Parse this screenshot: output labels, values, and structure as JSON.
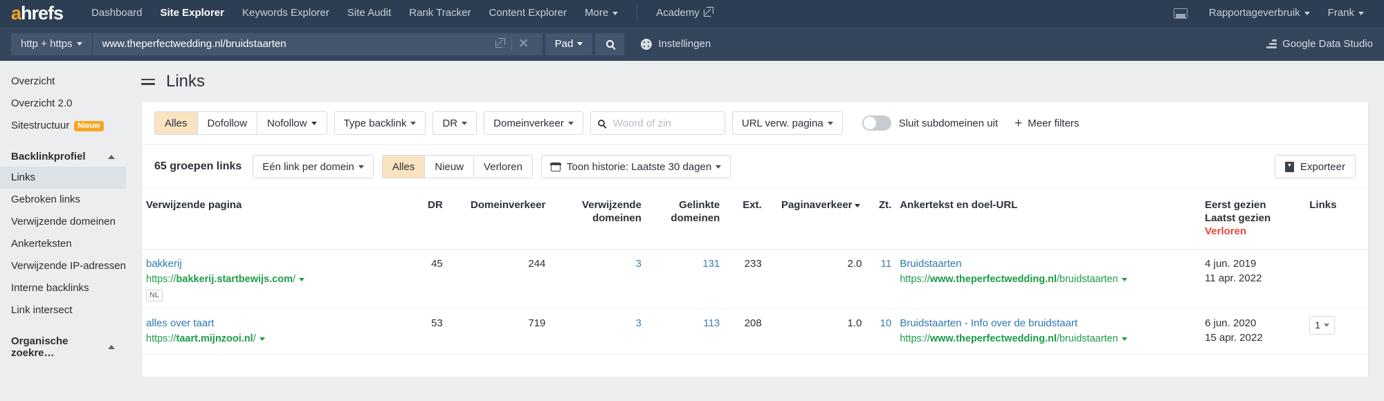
{
  "topnav": {
    "logo": "ahrefs",
    "logo_a": "a",
    "logo_rest": "hrefs",
    "items": [
      {
        "label": "Dashboard",
        "active": false,
        "caret": false
      },
      {
        "label": "Site Explorer",
        "active": true,
        "caret": false
      },
      {
        "label": "Keywords Explorer",
        "active": false,
        "caret": false
      },
      {
        "label": "Site Audit",
        "active": false,
        "caret": false
      },
      {
        "label": "Rank Tracker",
        "active": false,
        "caret": false
      },
      {
        "label": "Content Explorer",
        "active": false,
        "caret": false
      },
      {
        "label": "More",
        "active": false,
        "caret": true
      }
    ],
    "academy": "Academy",
    "report_usage": "Rapportageverbruik",
    "user": "Frank",
    "monitor_icon": "monitor-icon"
  },
  "searchbar": {
    "protocol": "http + https",
    "url_value": "www.theperfectwedding.nl/bruidstaarten",
    "open_external_icon": "external-link-icon",
    "clear_icon": "close-icon",
    "mode": "Pad",
    "search_icon": "search-icon",
    "settings": "Instellingen",
    "gear_icon": "gear-icon",
    "google_data_studio": "Google Data Studio",
    "gds_icon": "google-data-studio-icon"
  },
  "sidebar": {
    "top_items": [
      {
        "label": "Overzicht",
        "active": false
      },
      {
        "label": "Overzicht 2.0",
        "active": false
      },
      {
        "label": "Sitestructuur",
        "active": false,
        "badge": "Nieuw"
      }
    ],
    "section_title": "Backlinkprofiel",
    "items": [
      {
        "label": "Links",
        "active": true
      },
      {
        "label": "Gebroken links",
        "active": false
      },
      {
        "label": "Verwijzende domeinen",
        "active": false
      },
      {
        "label": "Ankerteksten",
        "active": false
      },
      {
        "label": "Verwijzende IP-adressen",
        "active": false
      },
      {
        "label": "Interne backlinks",
        "active": false
      },
      {
        "label": "Link intersect",
        "active": false
      }
    ],
    "section_title_2": "Organische zoekre…"
  },
  "page": {
    "title": "Links",
    "menu_icon": "hamburger-icon"
  },
  "filters": {
    "follow_segments": [
      {
        "label": "Alles",
        "on": true,
        "caret": false
      },
      {
        "label": "Dofollow",
        "on": false,
        "caret": false
      },
      {
        "label": "Nofollow",
        "on": false,
        "caret": true
      }
    ],
    "type_backlink": "Type backlink",
    "dr": "DR",
    "domeinverkeer": "Domeinverkeer",
    "search_placeholder": "Woord of zin",
    "search_value": "",
    "url_verw_pagina": "URL verw. pagina",
    "exclude_subdomains": "Sluit subdomeinen uit",
    "exclude_subdomains_on": false,
    "more_filters": "Meer filters"
  },
  "toolbar": {
    "groups_count": "65 groepen links",
    "per_domain": "Eén link per domein",
    "state_segments": [
      {
        "label": "Alles",
        "on": true
      },
      {
        "label": "Nieuw",
        "on": false
      },
      {
        "label": "Verloren",
        "on": false
      }
    ],
    "history": "Toon historie: Laatste 30 dagen",
    "calendar_icon": "calendar-icon",
    "export": "Exporteer",
    "export_icon": "download-icon"
  },
  "table": {
    "headers": {
      "referring_page": "Verwijzende pagina",
      "dr": "DR",
      "domain_traffic": "Domeinverkeer",
      "referring_domains": "Verwijzende domeinen",
      "linked_domains": "Gelinkte domeinen",
      "ext": "Ext.",
      "page_traffic": "Paginaverkeer",
      "zt": "Zt.",
      "anchor_target": "Ankertekst en doel-URL",
      "first_seen": "Eerst gezien",
      "last_seen": "Laatst gezien",
      "lost": "Verloren",
      "links": "Links"
    },
    "rows": [
      {
        "title": "bakkerij",
        "url_proto": "https://",
        "url_host": "bakkerij.startbewijs.com",
        "url_path": "/",
        "cc": "NL",
        "dr": "45",
        "domain_traffic": "244",
        "referring_domains": "3",
        "linked_domains": "131",
        "ext": "233",
        "page_traffic": "2.0",
        "zt": "11",
        "anchor": "Bruidstaarten",
        "target_proto": "https://",
        "target_host": "www.theperfectwedding.nl",
        "target_path": "/bruidstaarten",
        "first_seen": "4 jun. 2019",
        "last_seen": "11 apr. 2022",
        "links": ""
      },
      {
        "title": "alles over taart",
        "url_proto": "https://",
        "url_host": "taart.mijnzooi.nl",
        "url_path": "/",
        "cc": "",
        "dr": "53",
        "domain_traffic": "719",
        "referring_domains": "3",
        "linked_domains": "113",
        "ext": "208",
        "page_traffic": "1.0",
        "zt": "10",
        "anchor": "Bruidstaarten - Info over de bruidstaart",
        "target_proto": "https://",
        "target_host": "www.theperfectwedding.nl",
        "target_path": "/bruidstaarten",
        "first_seen": "6 jun. 2020",
        "last_seen": "15 apr. 2022",
        "links": "1"
      }
    ]
  }
}
